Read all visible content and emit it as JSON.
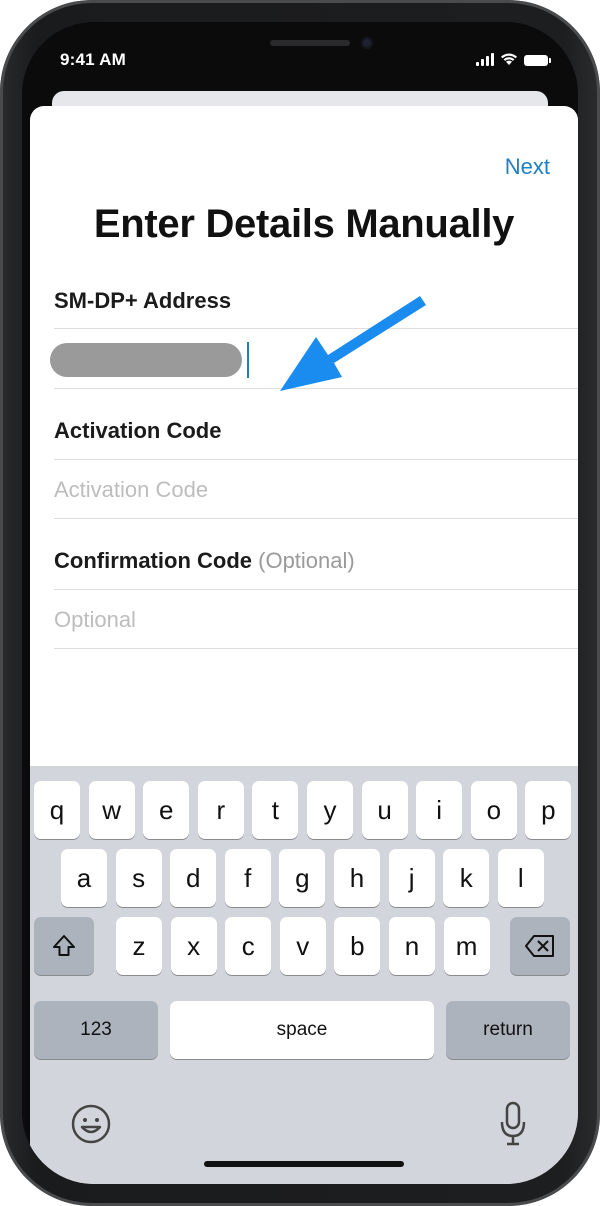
{
  "status_bar": {
    "time": "9:41 AM"
  },
  "header": {
    "next_label": "Next",
    "title": "Enter Details Manually"
  },
  "form": {
    "smdp": {
      "label": "SM-DP+ Address"
    },
    "activation": {
      "label": "Activation Code",
      "placeholder": "Activation Code"
    },
    "confirmation": {
      "label": "Confirmation Code",
      "optional": "(Optional)",
      "placeholder": "Optional"
    }
  },
  "keyboard": {
    "row1": [
      "q",
      "w",
      "e",
      "r",
      "t",
      "y",
      "u",
      "i",
      "o",
      "p"
    ],
    "row2": [
      "a",
      "s",
      "d",
      "f",
      "g",
      "h",
      "j",
      "k",
      "l"
    ],
    "row3": [
      "z",
      "x",
      "c",
      "v",
      "b",
      "n",
      "m"
    ],
    "numbers_label": "123",
    "space_label": "space",
    "return_label": "return"
  },
  "icons": {
    "shift": "shift-icon",
    "delete": "delete-icon",
    "emoji": "emoji-icon",
    "mic": "microphone-icon"
  },
  "colors": {
    "accent": "#1f7fbf",
    "arrow": "#1a8cf0",
    "keyboard_bg": "#d2d5db"
  }
}
